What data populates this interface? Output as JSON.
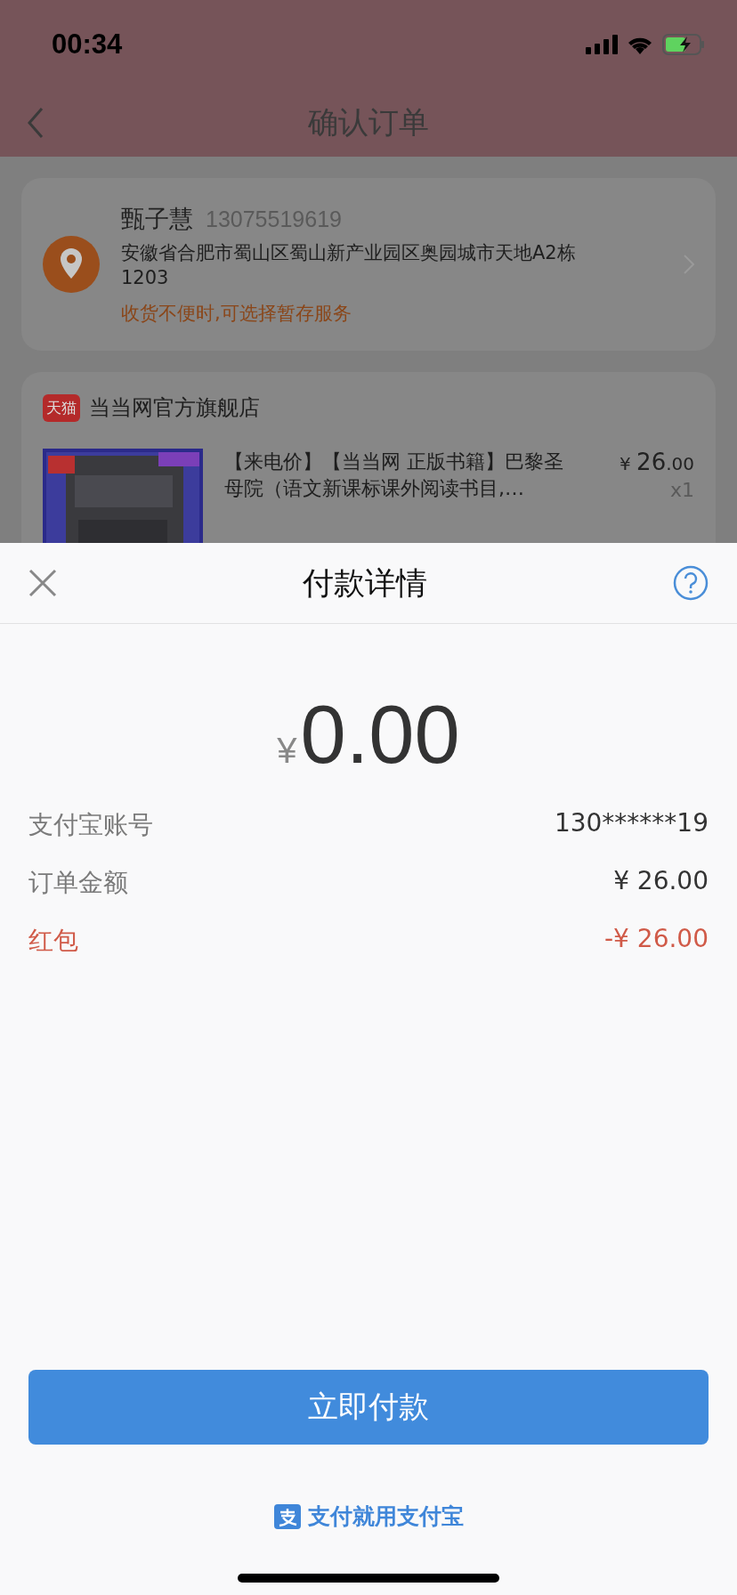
{
  "status_bar": {
    "time": "00:34"
  },
  "nav": {
    "title": "确认订单"
  },
  "address": {
    "name": "甄子慧",
    "phone": "13075519619",
    "address": "安徽省合肥市蜀山区蜀山新产业园区奥园城市天地A2栋1203",
    "note": "收货不便时,可选择暂存服务"
  },
  "store": {
    "badge": "天猫",
    "name": "当当网官方旗舰店"
  },
  "product": {
    "title": "【来电价】【当当网 正版书籍】巴黎圣母院（语文新课标课外阅读书目,…",
    "price_symbol": "¥",
    "price_int": "26",
    "price_dec": ".00",
    "quantity": "x1"
  },
  "payment_sheet": {
    "title": "付款详情",
    "amount_symbol": "¥",
    "amount": "0.00",
    "rows": [
      {
        "label": "支付宝账号",
        "value": "130******19",
        "kind": "normal"
      },
      {
        "label": "订单金额",
        "value": "¥ 26.00",
        "kind": "normal"
      },
      {
        "label": "红包",
        "value": "-¥ 26.00",
        "kind": "discount"
      }
    ],
    "pay_button": "立即付款",
    "footer": "支付就用支付宝"
  }
}
